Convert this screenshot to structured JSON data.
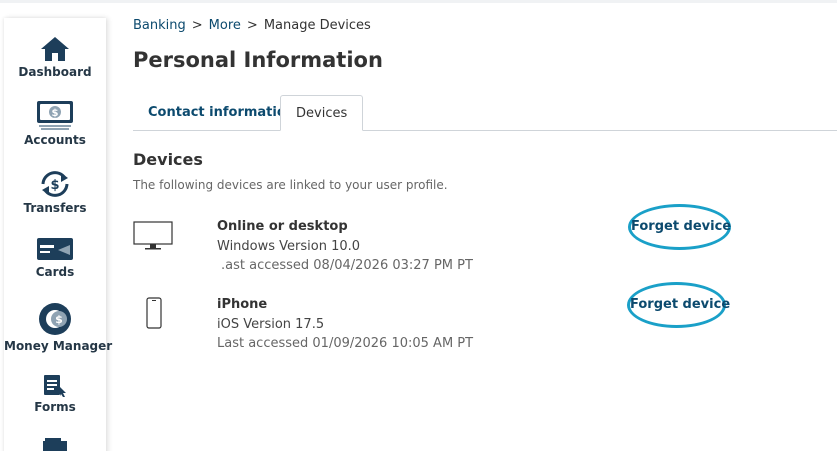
{
  "breadcrumb": {
    "items": [
      "Banking",
      "More"
    ],
    "current": "Manage Devices",
    "separator": ">"
  },
  "page": {
    "title": "Personal Information"
  },
  "tabs": [
    {
      "label": "Contact information",
      "active": false
    },
    {
      "label": "Devices",
      "active": true
    }
  ],
  "sidebar": {
    "items": [
      {
        "label": "Dashboard",
        "icon": "home-icon"
      },
      {
        "label": "Accounts",
        "icon": "cash-icon"
      },
      {
        "label": "Transfers",
        "icon": "transfer-icon"
      },
      {
        "label": "Cards",
        "icon": "card-icon"
      },
      {
        "label": "Money Manager",
        "icon": "money-manager-icon"
      },
      {
        "label": "Forms",
        "icon": "forms-icon"
      }
    ]
  },
  "devices_section": {
    "title": "Devices",
    "description": "The following devices are linked to your user profile.",
    "devices": [
      {
        "name": "Online or desktop",
        "version": "Windows Version 10.0",
        "last_accessed": ".ast accessed 08/04/2026 03:27 PM PT",
        "icon": "desktop-icon",
        "action": "Forget device"
      },
      {
        "name": "iPhone",
        "version": "iOS Version 17.5",
        "last_accessed": "Last accessed 01/09/2026 10:05 AM PT",
        "icon": "phone-icon",
        "action": "Forget device"
      }
    ]
  },
  "colors": {
    "accent": "#0c4a6e",
    "highlight_ring": "#1aa0c8",
    "nav_icon": "#1d3e5a"
  }
}
